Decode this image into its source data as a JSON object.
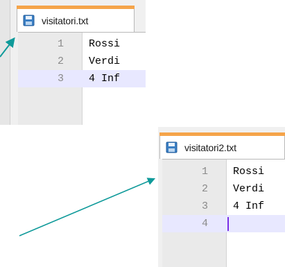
{
  "top_editor": {
    "tab_title": "visitatori.txt",
    "lines": [
      {
        "no": "1",
        "text": "Rossi"
      },
      {
        "no": "2",
        "text": "Verdi"
      },
      {
        "no": "3",
        "text": "4 Inf"
      }
    ]
  },
  "bottom_editor": {
    "tab_title": "visitatori2.txt",
    "lines": [
      {
        "no": "1",
        "text": "Rossi"
      },
      {
        "no": "2",
        "text": "Verdi"
      },
      {
        "no": "3",
        "text": "4 Inf"
      },
      {
        "no": "4",
        "text": ""
      }
    ]
  },
  "colors": {
    "tab_accent": "#f5a44a",
    "arrow": "#0f9a9a",
    "current_line": "#e8e8ff",
    "caret": "#7a2ee6"
  },
  "icons": [
    "save-file-icon",
    "arrow"
  ]
}
